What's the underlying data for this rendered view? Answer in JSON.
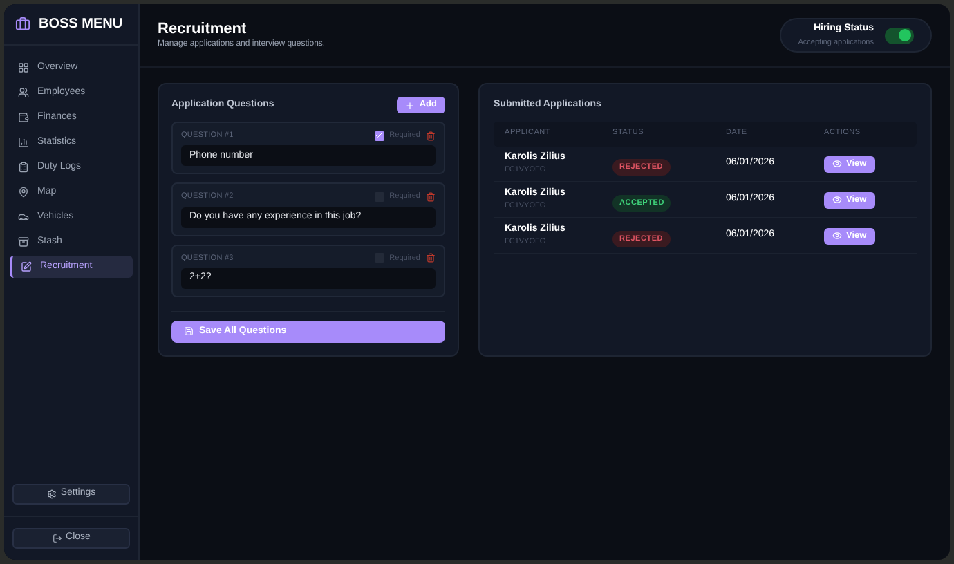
{
  "brand": "BOSS MENU",
  "sidebar": {
    "items": [
      {
        "label": "Overview",
        "kind": "grid",
        "selected": false
      },
      {
        "label": "Employees",
        "kind": "users",
        "selected": false
      },
      {
        "label": "Finances",
        "kind": "wallet",
        "selected": false
      },
      {
        "label": "Statistics",
        "kind": "chart",
        "selected": false
      },
      {
        "label": "Duty Logs",
        "kind": "clipboard",
        "selected": false
      },
      {
        "label": "Map",
        "kind": "pin",
        "selected": false
      },
      {
        "label": "Vehicles",
        "kind": "car",
        "selected": false
      },
      {
        "label": "Stash",
        "kind": "archive",
        "selected": false
      },
      {
        "label": "Recruitment",
        "kind": "edit",
        "selected": true
      }
    ],
    "settings": "Settings",
    "close": "Close"
  },
  "header": {
    "title": "Recruitment",
    "subtitle": "Manage applications and interview questions.",
    "hiring": {
      "label": "Hiring Status",
      "sublabel": "Accepting applications",
      "on": true
    }
  },
  "questions": {
    "title": "Application Questions",
    "add": "Add",
    "save": "Save All Questions",
    "items": [
      {
        "label": "QUESTION #1",
        "required_label": "Required",
        "required": true,
        "value": "Phone number"
      },
      {
        "label": "QUESTION #2",
        "required_label": "Required",
        "required": false,
        "value": "Do you have any experience in this job?"
      },
      {
        "label": "QUESTION #3",
        "required_label": "Required",
        "required": false,
        "value": "2+2?"
      }
    ]
  },
  "applications": {
    "title": "Submitted Applications",
    "columns": [
      "APPLICANT",
      "STATUS",
      "DATE",
      "ACTIONS"
    ],
    "rows": [
      {
        "name": "Karolis Zilius",
        "id": "FC1VYOFG",
        "status": "REJECTED",
        "kind": "rejected",
        "date": "06/01/2026",
        "action": "View"
      },
      {
        "name": "Karolis Zilius",
        "id": "FC1VYOFG",
        "status": "ACCEPTED",
        "kind": "accepted",
        "date": "06/01/2026",
        "action": "View"
      },
      {
        "name": "Karolis Zilius",
        "id": "FC1VYOFG",
        "status": "REJECTED",
        "kind": "rejected",
        "date": "06/01/2026",
        "action": "View"
      }
    ]
  }
}
